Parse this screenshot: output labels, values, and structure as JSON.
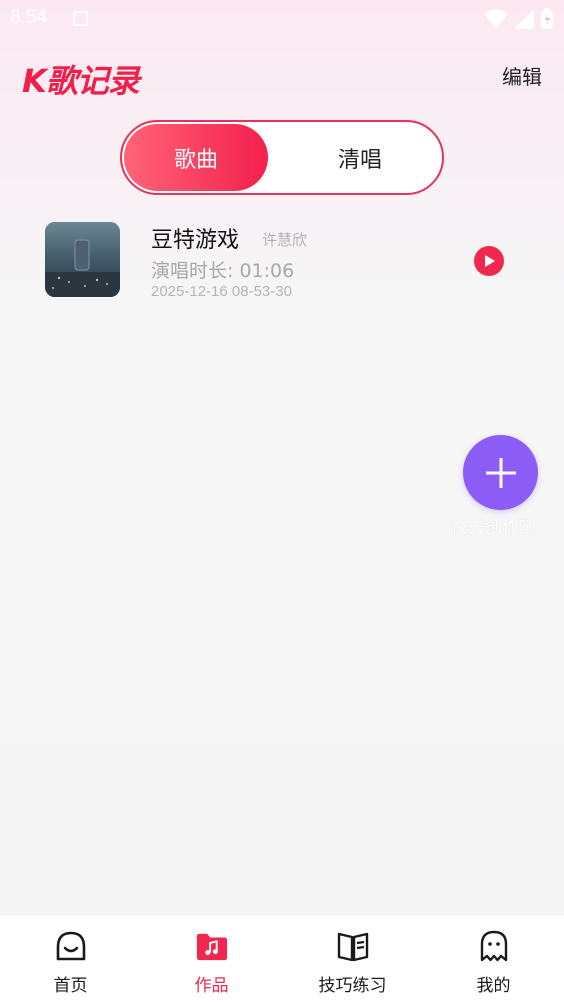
{
  "status_bar": {
    "time": "8:54"
  },
  "header": {
    "title": "K歌记录",
    "edit_label": "编辑"
  },
  "tabs": [
    {
      "label": "歌曲",
      "active": true
    },
    {
      "label": "清唱",
      "active": false
    }
  ],
  "songs": [
    {
      "title": "豆特游戏",
      "artist": "许慧欣",
      "duration": "演唱时长:  01:06",
      "date": "2025-12-16 08-53-30",
      "cover_icon": "album-cover-image"
    }
  ],
  "fab": {
    "label": "快去创作吧",
    "icon": "plus-icon"
  },
  "bottom_nav": [
    {
      "label": "首页",
      "icon": "home-face-icon",
      "active": false
    },
    {
      "label": "作品",
      "icon": "music-folder-icon",
      "active": true
    },
    {
      "label": "技巧练习",
      "icon": "book-icon",
      "active": false
    },
    {
      "label": "我的",
      "icon": "ghost-icon",
      "active": false
    }
  ],
  "colors": {
    "accent": "#f0284f",
    "fab": "#8b5cf6"
  }
}
